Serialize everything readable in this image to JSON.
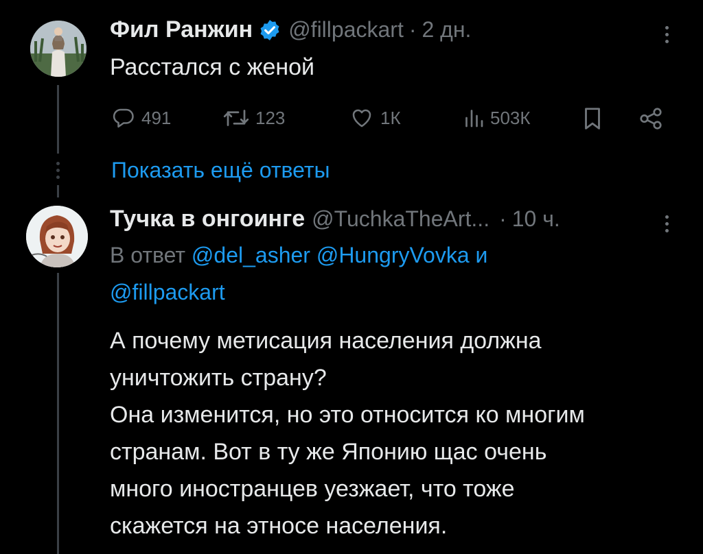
{
  "tweet": {
    "author_name": "Фил Ранжин",
    "handle": "@fillpackart",
    "separator": "·",
    "time": "2 дн.",
    "text": "Расстался с женой",
    "actions": {
      "replies": "491",
      "retweets": "123",
      "likes": "1К",
      "views": "503К"
    }
  },
  "show_more_replies": "Показать ещё ответы",
  "reply": {
    "author_name": "Тучка в онгоинге",
    "handle": "@TuchkaTheArt...",
    "separator": "·",
    "time": "10 ч.",
    "reply_prefix": "В ответ",
    "mention_1": "@del_asher",
    "mention_2": "@HungryVovka",
    "conjunction": "и",
    "mention_3": "@fillpackart",
    "lines": [
      "А почему метисация населения должна",
      "уничтожить страну?",
      "Она изменится, но это относится ко многим",
      "странам. Вот в ту же Японию щас очень",
      "много иностранцев уезжает, что тоже",
      "скажется на этносе населения."
    ]
  },
  "colors": {
    "background": "#000000",
    "text": "#e7e9ea",
    "muted": "#71767b",
    "link": "#1d9bf0",
    "verified": "#1d9bf0",
    "thread_line": "#3b4046"
  }
}
